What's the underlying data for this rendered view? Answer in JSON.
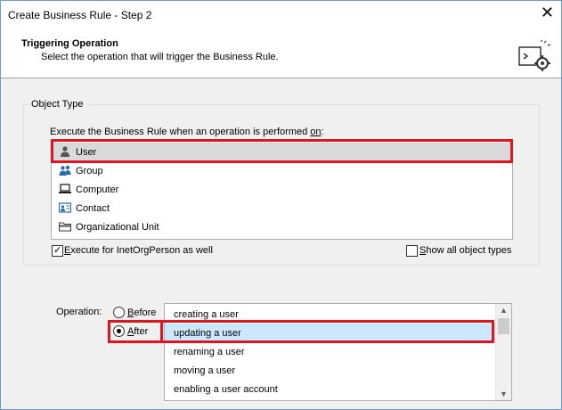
{
  "window": {
    "title": "Create Business Rule - Step 2"
  },
  "header": {
    "title": "Triggering Operation",
    "subtitle": "Select the operation that will trigger the Business Rule."
  },
  "object_type": {
    "legend": "Object Type",
    "prompt_pre": "Execute the Business Rule when an operation is performed ",
    "prompt_ul": "on",
    "prompt_post": ":",
    "items": [
      {
        "label": "User",
        "icon": "user-icon",
        "selected": true
      },
      {
        "label": "Group",
        "icon": "group-icon"
      },
      {
        "label": "Computer",
        "icon": "computer-icon"
      },
      {
        "label": "Contact",
        "icon": "contact-icon"
      },
      {
        "label": "Organizational Unit",
        "icon": "folder-icon"
      }
    ],
    "inetorg": {
      "label_ul": "E",
      "label_rest": "xecute for InetOrgPerson as well",
      "checked": true
    },
    "show_all": {
      "label_ul": "S",
      "label_rest": "how all object types",
      "checked": false
    }
  },
  "operation": {
    "label": "Operation:",
    "before": {
      "ul": "B",
      "rest": "efore",
      "checked": false
    },
    "after": {
      "ul": "A",
      "rest": "fter",
      "checked": true
    },
    "items": [
      {
        "label": "creating a user"
      },
      {
        "label": "updating a user",
        "selected": true
      },
      {
        "label": "renaming a user"
      },
      {
        "label": "moving a user"
      },
      {
        "label": "enabling a user account"
      }
    ]
  }
}
